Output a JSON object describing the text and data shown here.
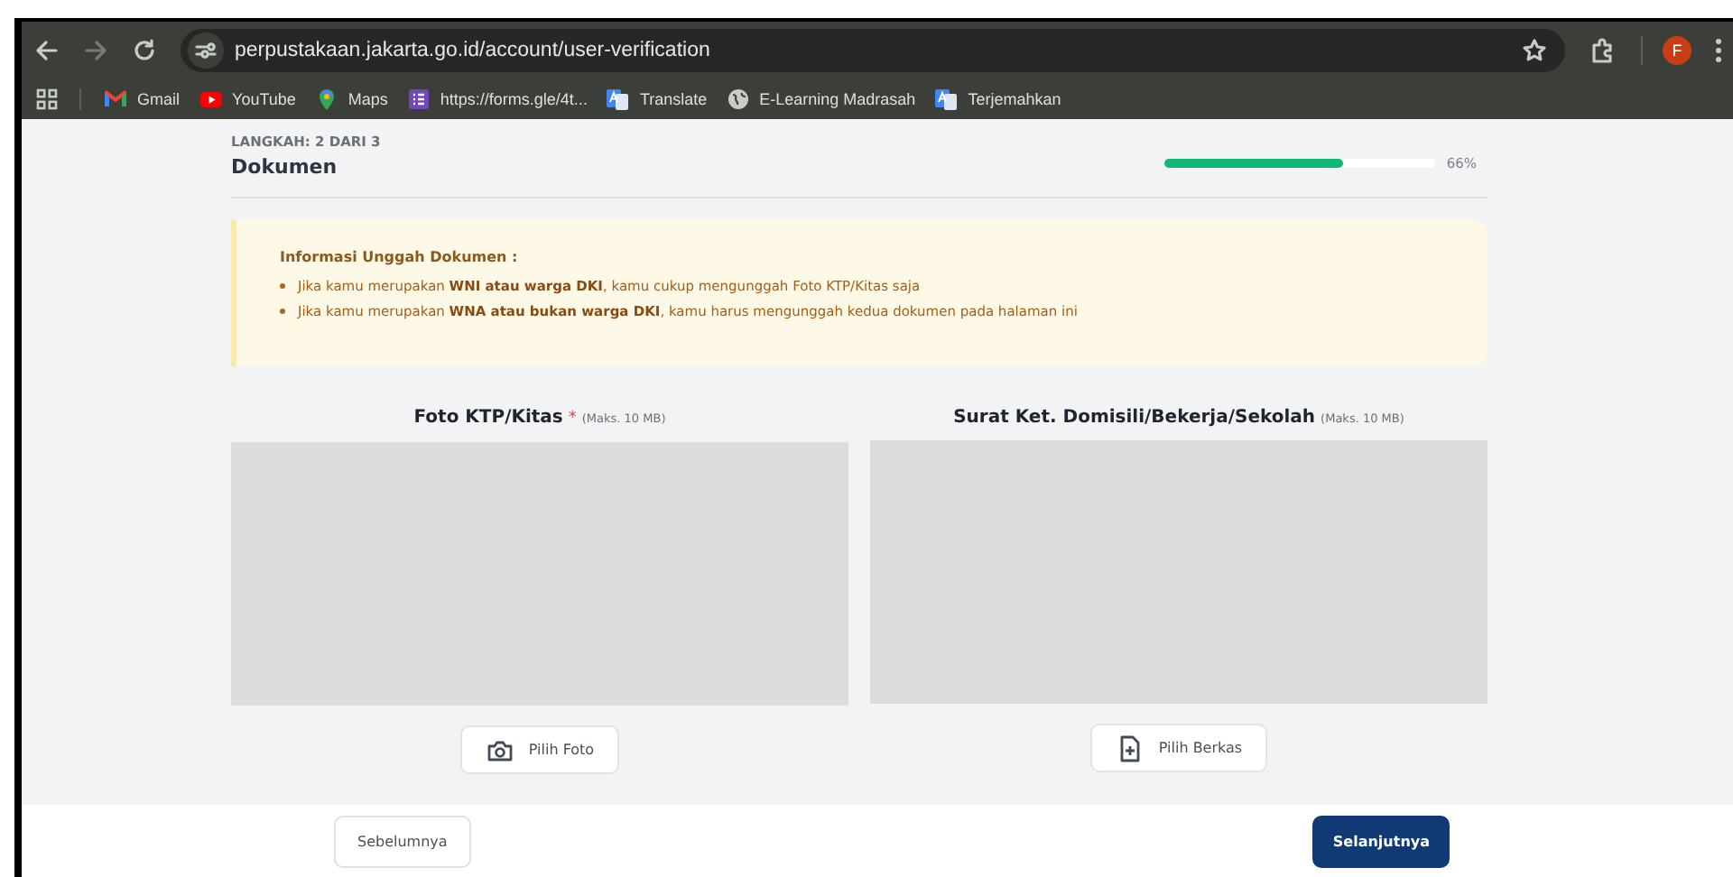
{
  "browser": {
    "url": "perpustakaan.jakarta.go.id/account/user-verification",
    "profile_initial": "F",
    "bookmarks": [
      {
        "kind": "gmail",
        "label": "Gmail"
      },
      {
        "kind": "youtube",
        "label": "YouTube"
      },
      {
        "kind": "maps",
        "label": "Maps"
      },
      {
        "kind": "forms",
        "label": "https://forms.gle/4t..."
      },
      {
        "kind": "translate",
        "label": "Translate"
      },
      {
        "kind": "globe",
        "label": "E-Learning Madrasah"
      },
      {
        "kind": "translate",
        "label": "Terjemahkan"
      }
    ]
  },
  "step": {
    "label": "LANGKAH: 2 DARI 3",
    "title": "Dokumen",
    "level": 0.66,
    "reading": "66%"
  },
  "info": {
    "title": "Informasi Unggah Dokumen :",
    "items": [
      "Jika kamu merupakan **WNI atau warga DKI**, kamu cukup mengunggah Foto KTP/Kitas saja",
      "Jika kamu merupakan **WNA atau bukan warga DKI**, kamu harus mengunggah kedua dokumen pada halaman ini"
    ]
  },
  "uploads": [
    {
      "title": "Foto KTP/Kitas",
      "required_mark": "*",
      "limit": "(Maks. 10 MB)",
      "button": {
        "kind": "camera",
        "label": "Pilih Foto"
      }
    },
    {
      "title": "Surat Ket. Domisili/Bekerja/Sekolah",
      "limit": "(Maks. 10 MB)",
      "button": {
        "kind": "file",
        "label": "Pilih Berkas"
      }
    }
  ],
  "footer": {
    "back": "Sebelumnya",
    "next": "Selanjutnya"
  }
}
